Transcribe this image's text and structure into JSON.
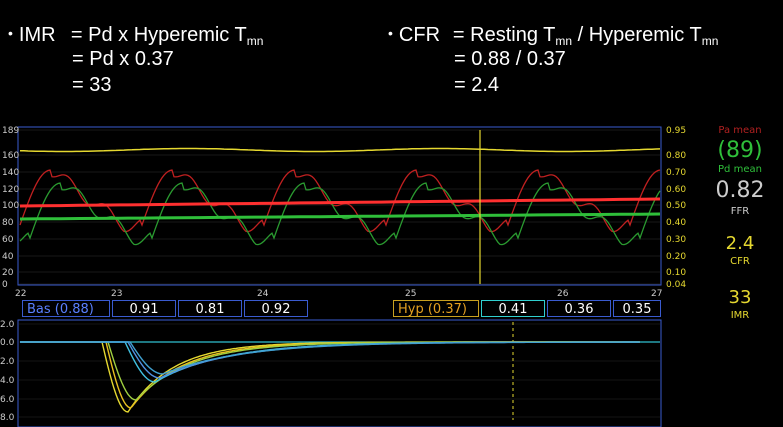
{
  "formulas": {
    "imr": {
      "bullet": "•",
      "name": "IMR",
      "line1_a": "= Pd x Hyperemic T",
      "line1_sub": "mn",
      "line2": "= Pd x 0.37",
      "line3": "= 33"
    },
    "cfr": {
      "bullet": "•",
      "name": "CFR",
      "line1_a": "= Resting T",
      "line1_sub": "mn",
      "line1_b": " / Hyperemic T",
      "line1_sub2": "mn",
      "line2": "= 0.88 / 0.37",
      "line3": "= 2.4"
    }
  },
  "readouts": {
    "pa_mean_label": "Pa mean",
    "pd_value": "(89)",
    "pd_mean_label": "Pd mean",
    "ffr_value": "0.82",
    "ffr_label": "FFR",
    "cfr_value": "2.4",
    "cfr_label": "CFR",
    "imr_value": "33",
    "imr_label": "IMR"
  },
  "pressure_axis": {
    "left_ticks": [
      "189",
      "160",
      "140",
      "120",
      "100",
      "80",
      "60",
      "40",
      "20",
      "0"
    ],
    "right_ticks": [
      "0.95",
      "0.80",
      "0.70",
      "0.60",
      "0.50",
      "0.40",
      "0.30",
      "0.20",
      "0.10",
      "0.04"
    ],
    "time_ticks": [
      "22",
      "23",
      "24",
      "25",
      "26",
      "27"
    ]
  },
  "transit_boxes": {
    "baseline_label": "Bas (0.88)",
    "baseline_values": [
      "0.91",
      "0.81",
      "0.92"
    ],
    "hyperemic_label": "Hyp (0.37)",
    "hyperemic_values": [
      "0.41",
      "0.36",
      "0.35"
    ]
  },
  "thermo_axis": {
    "left_ticks": [
      "2.0",
      "0.0",
      "2.0",
      "4.0",
      "6.0",
      "8.0"
    ]
  },
  "colors": {
    "pa": "#e02a2a",
    "pd": "#2fbf3a",
    "aortic_mean": "#ff4040",
    "yellow": "#e5d830",
    "box_border": "#3a5bd0",
    "box_hyp_border": "#c8a020",
    "box_hyp_cyan": "#30d0d0",
    "grid": "#555"
  }
}
